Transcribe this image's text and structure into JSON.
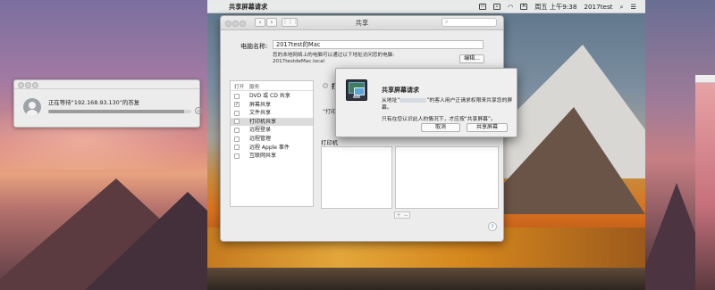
{
  "menubar": {
    "app_name": "共享屏幕请求",
    "input_indicator": "A",
    "clock": "周五 上午9:38",
    "user": "2017test"
  },
  "connect_dialog": {
    "status_text": "正在等待“192.168.93.130”的答复",
    "progress": 0.95
  },
  "sharing_window": {
    "title": "共享",
    "computer_name_label": "电脑名称:",
    "computer_name_value": "2017test的Mac",
    "name_description_line1": "您的本地网络上的电脑可以通过以下地址访问您的电脑:",
    "name_description_line2": "2017testdeMac.local",
    "edit_label": "编辑...",
    "list_header_on": "打开",
    "list_header_service": "服务",
    "services": [
      {
        "label": "DVD 或 CD 共享",
        "checked": false,
        "selected": false
      },
      {
        "label": "屏幕共享",
        "checked": true,
        "selected": false
      },
      {
        "label": "文件共享",
        "checked": false,
        "selected": false
      },
      {
        "label": "打印机共享",
        "checked": false,
        "selected": true
      },
      {
        "label": "远程登录",
        "checked": false,
        "selected": false
      },
      {
        "label": "远程管理",
        "checked": false,
        "selected": false
      },
      {
        "label": "远程 Apple 事件",
        "checked": false,
        "selected": false
      },
      {
        "label": "互联网共享",
        "checked": false,
        "selected": false
      }
    ],
    "status_title": "打",
    "status_sub": "“打印",
    "printers_label": "打印机",
    "help_label": "?"
  },
  "request_sheet": {
    "title": "共享屏幕请求",
    "message_prefix": "从地址“",
    "message_suffix": "”的客人用户正请求权限来共享您的屏幕。",
    "note": "只有在您认识此人的情况下，才应按“共享屏幕”。",
    "cancel_label": "取消",
    "share_label": "共享屏幕"
  }
}
